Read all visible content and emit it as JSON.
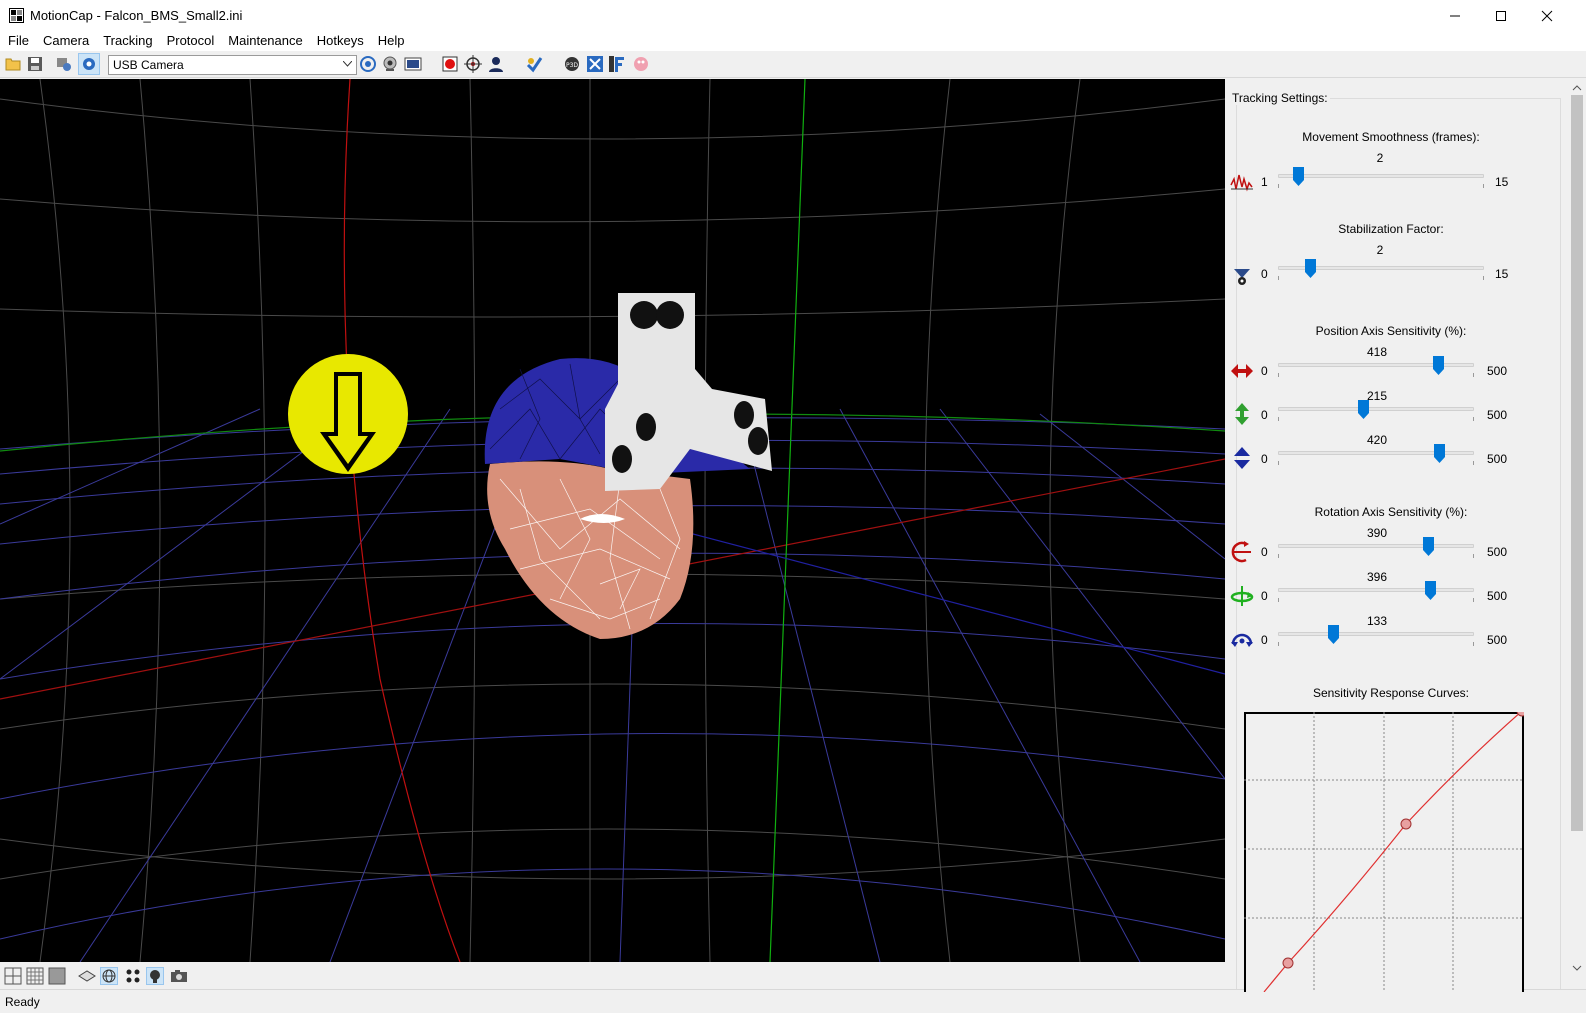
{
  "window": {
    "title": "MotionCap - Falcon_BMS_Small2.ini",
    "minimize": "—",
    "maximize": "☐",
    "close": "✕"
  },
  "menu": [
    "File",
    "Camera",
    "Tracking",
    "Protocol",
    "Maintenance",
    "Hotkeys",
    "Help"
  ],
  "toolbar": {
    "camera_select": "USB Camera"
  },
  "status": "Ready",
  "panel": {
    "group_title": "Tracking Settings:",
    "smoothness": {
      "title": "Movement Smoothness (frames):",
      "value": "2",
      "min": "1",
      "max": "15",
      "level": 2
    },
    "stabilization": {
      "title": "Stabilization Factor:",
      "value": "2",
      "min": "0",
      "max": "15",
      "level": 2
    },
    "position": {
      "title": "Position Axis Sensitivity (%):",
      "axes": [
        {
          "icon": "x-axis-arrows-icon",
          "value": "418",
          "min": "0",
          "max": "500"
        },
        {
          "icon": "y-axis-arrows-icon",
          "value": "215",
          "min": "0",
          "max": "500"
        },
        {
          "icon": "z-axis-arrows-icon",
          "value": "420",
          "min": "0",
          "max": "500"
        }
      ]
    },
    "rotation": {
      "title": "Rotation Axis Sensitivity (%):",
      "axes": [
        {
          "icon": "pitch-rotation-icon",
          "value": "390",
          "min": "0",
          "max": "500"
        },
        {
          "icon": "yaw-rotation-icon",
          "value": "396",
          "min": "0",
          "max": "500"
        },
        {
          "icon": "roll-rotation-icon",
          "value": "133",
          "min": "0",
          "max": "500"
        }
      ]
    },
    "curves_title": "Sensitivity Response Curves:"
  },
  "colors": {
    "accent": "#0078d7",
    "viewport_bg": "#000000",
    "grid": "#4a4a4a",
    "target_yellow": "#e8e800",
    "cap_blue": "#2a2aa8",
    "face": "#d8907a",
    "curve_red": "#e03030"
  }
}
